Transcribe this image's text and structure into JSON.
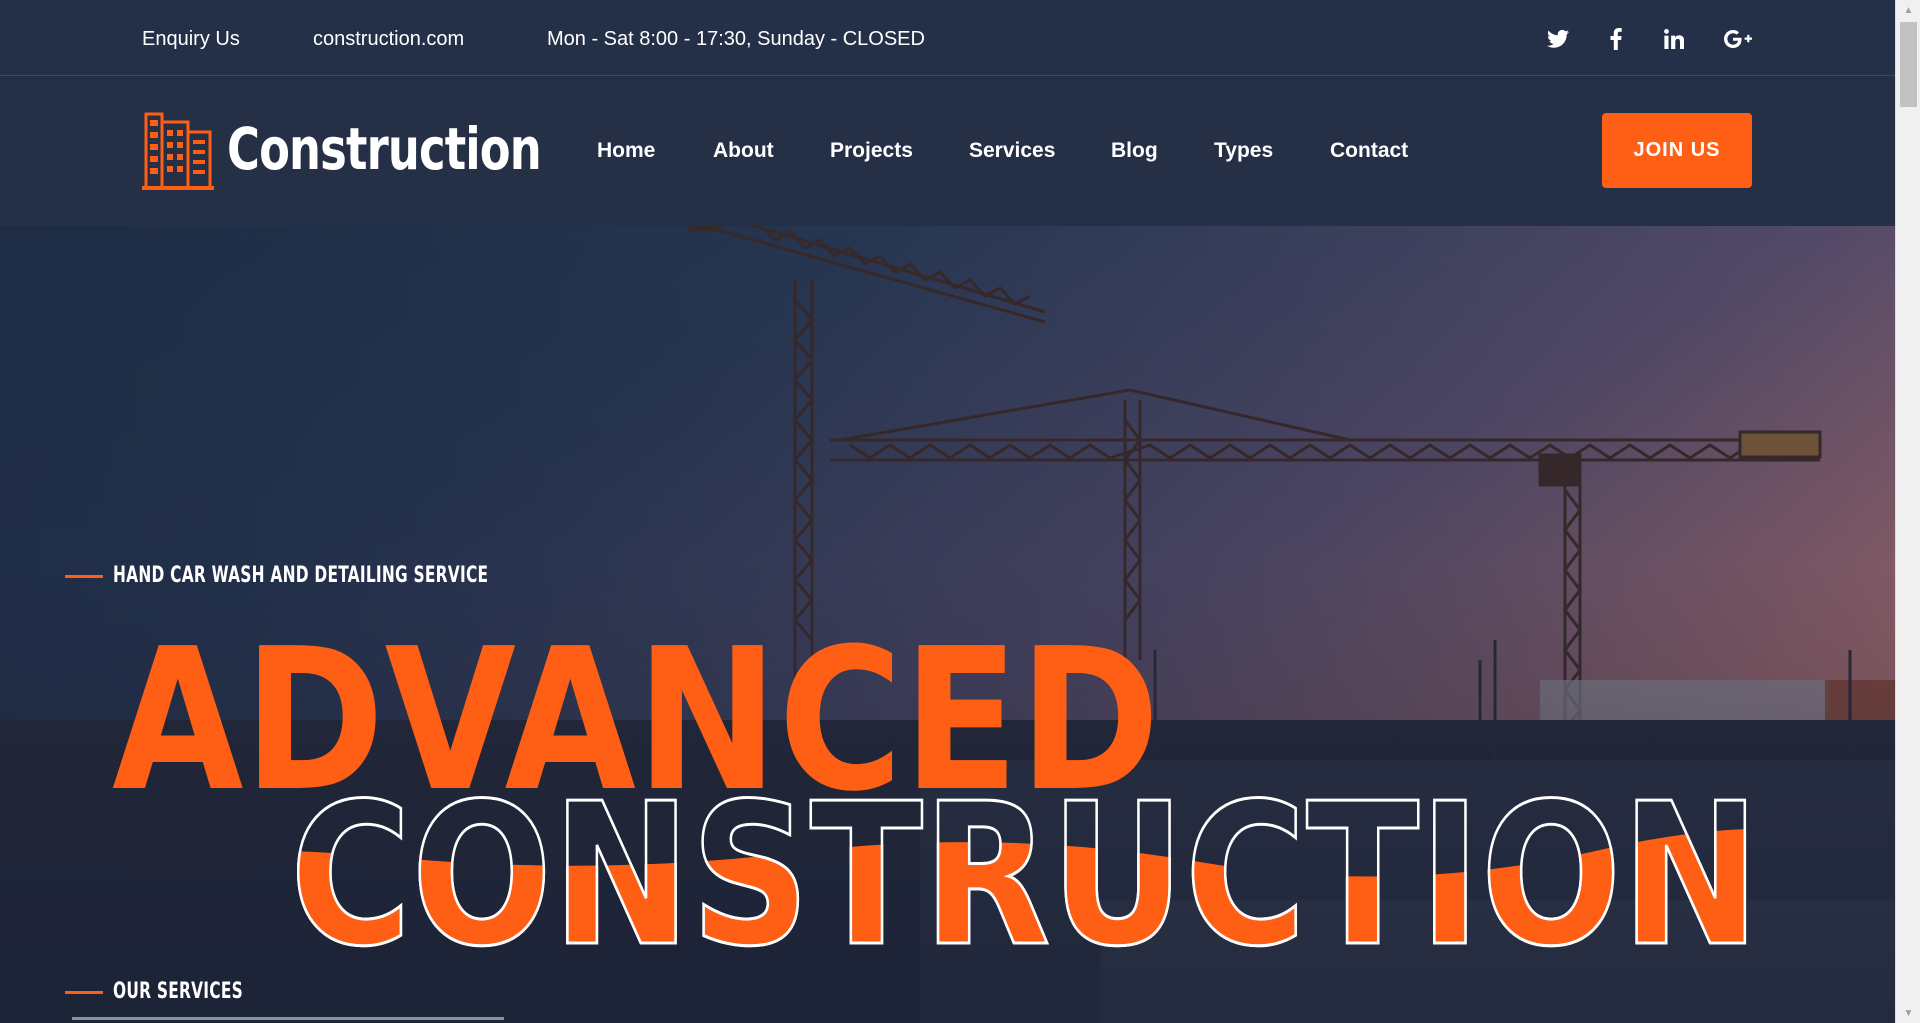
{
  "topbar": {
    "enquiry": "Enquiry Us",
    "website": "construction.com",
    "hours": "Mon - Sat 8:00 - 17:30, Sunday - CLOSED",
    "social_icons": [
      "twitter-icon",
      "facebook-icon",
      "linkedin-icon",
      "google-plus-icon"
    ]
  },
  "header": {
    "logo_text": "Construction",
    "nav": [
      "Home",
      "About",
      "Projects",
      "Services",
      "Blog",
      "Types",
      "Contact"
    ],
    "cta_label": "JOIN US"
  },
  "hero": {
    "eyebrow": "HAND CAR WASH AND DETAILING SERVICE",
    "headline_line1": "ADVANCED",
    "headline_line2": "CONSTRUCTION",
    "section_label": "OUR SERVICES"
  },
  "colors": {
    "accent": "#ff5f15",
    "navy": "#253047",
    "white": "#ffffff"
  }
}
